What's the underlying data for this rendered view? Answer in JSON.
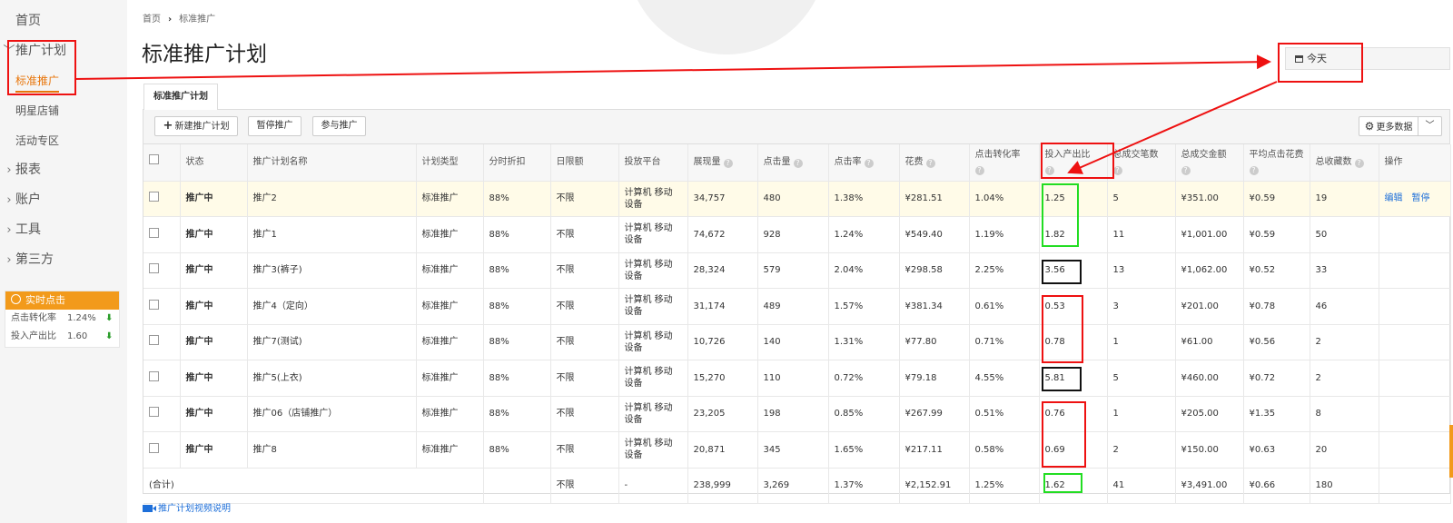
{
  "sidebar": {
    "home": "首页",
    "promo_plan": "推广计划",
    "standard_promo": "标准推广",
    "star_shop": "明星店铺",
    "activity_zone": "活动专区",
    "reports": "报表",
    "account": "账户",
    "tools": "工具",
    "third_party": "第三方"
  },
  "realtime": {
    "title": "实时点击",
    "conv_label": "点击转化率",
    "conv_value": "1.24%",
    "roi_label": "投入产出比",
    "roi_value": "1.60"
  },
  "breadcrumb": {
    "home": "首页",
    "current": "标准推广"
  },
  "page_title": "标准推广计划",
  "date_filter": "今天",
  "tab_label": "标准推广计划",
  "toolbar": {
    "new_plan": "新建推广计划",
    "pause": "暂停推广",
    "join": "参与推广",
    "more_data": "更多数据"
  },
  "columns": {
    "status": "状态",
    "name": "推广计划名称",
    "type": "计划类型",
    "discount": "分时折扣",
    "budget": "日限额",
    "platform": "投放平台",
    "impressions": "展现量",
    "clicks": "点击量",
    "ctr": "点击率",
    "cost": "花费",
    "cvr": "点击转化率",
    "roi": "投入产出比",
    "orders": "总成交笔数",
    "gmv": "总成交金额",
    "cpc": "平均点击花费",
    "favorites": "总收藏数",
    "ops": "操作"
  },
  "rows": [
    {
      "status": "推广中",
      "name": "推广2",
      "type": "标准推广",
      "discount": "88%",
      "budget": "不限",
      "platform": "计算机 移动设备",
      "impressions": "34,757",
      "clicks": "480",
      "ctr": "1.38%",
      "cost": "¥281.51",
      "cvr": "1.04%",
      "roi": "1.25",
      "orders": "5",
      "gmv": "¥351.00",
      "cpc": "¥0.59",
      "favorites": "19",
      "edit": "编辑",
      "pause": "暂停"
    },
    {
      "status": "推广中",
      "name": "推广1",
      "type": "标准推广",
      "discount": "88%",
      "budget": "不限",
      "platform": "计算机 移动设备",
      "impressions": "74,672",
      "clicks": "928",
      "ctr": "1.24%",
      "cost": "¥549.40",
      "cvr": "1.19%",
      "roi": "1.82",
      "orders": "11",
      "gmv": "¥1,001.00",
      "cpc": "¥0.59",
      "favorites": "50"
    },
    {
      "status": "推广中",
      "name": "推广3(裤子)",
      "type": "标准推广",
      "discount": "88%",
      "budget": "不限",
      "platform": "计算机 移动设备",
      "impressions": "28,324",
      "clicks": "579",
      "ctr": "2.04%",
      "cost": "¥298.58",
      "cvr": "2.25%",
      "roi": "3.56",
      "orders": "13",
      "gmv": "¥1,062.00",
      "cpc": "¥0.52",
      "favorites": "33"
    },
    {
      "status": "推广中",
      "name": "推广4（定向）",
      "type": "标准推广",
      "discount": "88%",
      "budget": "不限",
      "platform": "计算机 移动设备",
      "impressions": "31,174",
      "clicks": "489",
      "ctr": "1.57%",
      "cost": "¥381.34",
      "cvr": "0.61%",
      "roi": "0.53",
      "orders": "3",
      "gmv": "¥201.00",
      "cpc": "¥0.78",
      "favorites": "46"
    },
    {
      "status": "推广中",
      "name": "推广7(测试)",
      "type": "标准推广",
      "discount": "88%",
      "budget": "不限",
      "platform": "计算机 移动设备",
      "impressions": "10,726",
      "clicks": "140",
      "ctr": "1.31%",
      "cost": "¥77.80",
      "cvr": "0.71%",
      "roi": "0.78",
      "orders": "1",
      "gmv": "¥61.00",
      "cpc": "¥0.56",
      "favorites": "2"
    },
    {
      "status": "推广中",
      "name": "推广5(上衣)",
      "type": "标准推广",
      "discount": "88%",
      "budget": "不限",
      "platform": "计算机 移动设备",
      "impressions": "15,270",
      "clicks": "110",
      "ctr": "0.72%",
      "cost": "¥79.18",
      "cvr": "4.55%",
      "roi": "5.81",
      "orders": "5",
      "gmv": "¥460.00",
      "cpc": "¥0.72",
      "favorites": "2"
    },
    {
      "status": "推广中",
      "name": "推广06（店铺推广）",
      "type": "标准推广",
      "discount": "88%",
      "budget": "不限",
      "platform": "计算机 移动设备",
      "impressions": "23,205",
      "clicks": "198",
      "ctr": "0.85%",
      "cost": "¥267.99",
      "cvr": "0.51%",
      "roi": "0.76",
      "orders": "1",
      "gmv": "¥205.00",
      "cpc": "¥1.35",
      "favorites": "8"
    },
    {
      "status": "推广中",
      "name": "推广8",
      "type": "标准推广",
      "discount": "88%",
      "budget": "不限",
      "platform": "计算机 移动设备",
      "impressions": "20,871",
      "clicks": "345",
      "ctr": "1.65%",
      "cost": "¥217.11",
      "cvr": "0.58%",
      "roi": "0.69",
      "orders": "2",
      "gmv": "¥150.00",
      "cpc": "¥0.63",
      "favorites": "20"
    }
  ],
  "total": {
    "label": "(合计)",
    "budget": "不限",
    "platform": "-",
    "impressions": "238,999",
    "clicks": "3,269",
    "ctr": "1.37%",
    "cost": "¥2,152.91",
    "cvr": "1.25%",
    "roi": "1.62",
    "orders": "41",
    "gmv": "¥3,491.00",
    "cpc": "¥0.66",
    "favorites": "180"
  },
  "video_link": "推广计划视频说明",
  "annotation_colors": {
    "red": "#ee1111",
    "green": "#22dd22",
    "black": "#111111"
  },
  "colors": {
    "accent": "#e8750a",
    "status_green": "#2a9d2a",
    "link_blue": "#1e6fd9"
  }
}
